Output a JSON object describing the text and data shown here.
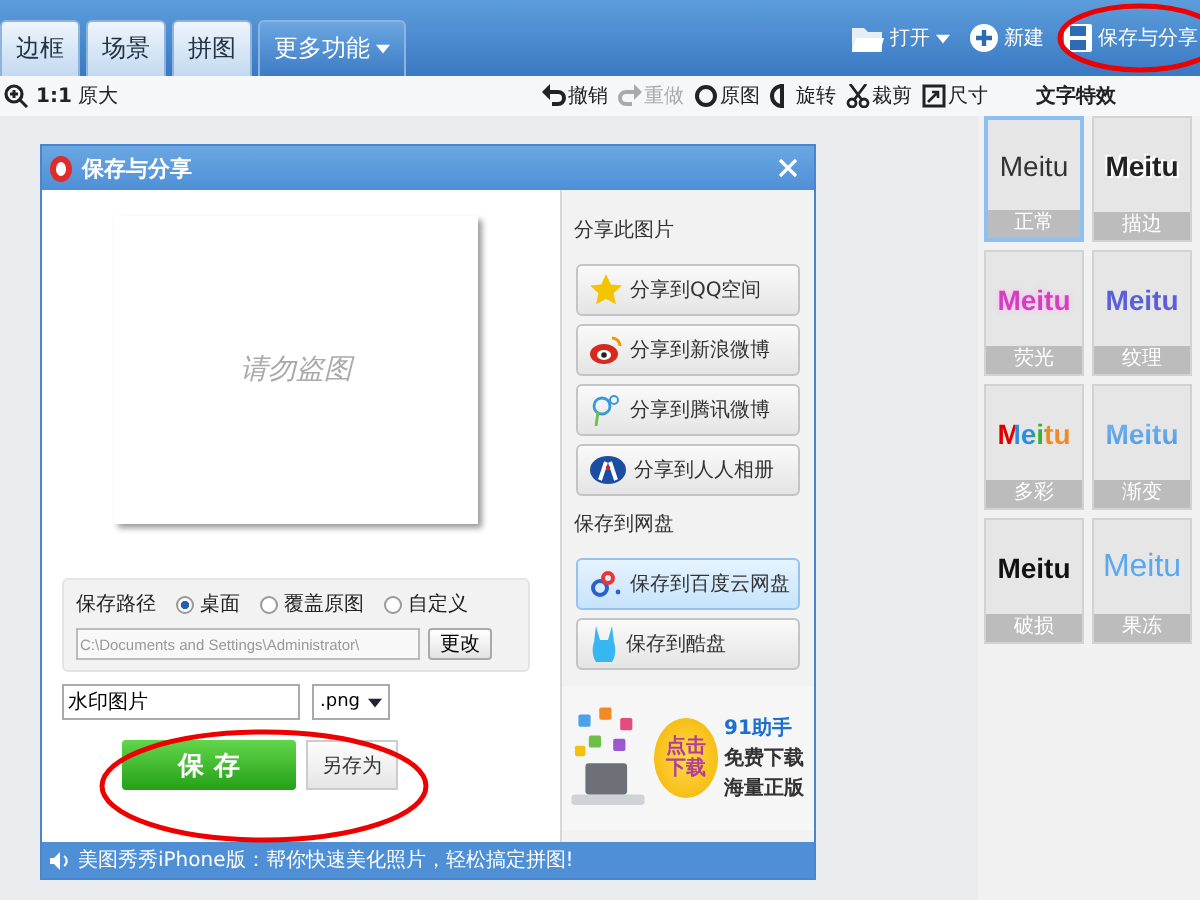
{
  "top_bar": {
    "tabs": [
      {
        "label": "边框",
        "kind": "tab"
      },
      {
        "label": "场景",
        "kind": "tab"
      },
      {
        "label": "拼图",
        "kind": "tab"
      },
      {
        "label": "更多功能",
        "kind": "menu"
      }
    ],
    "actions": [
      {
        "label": "打开",
        "kind": "open"
      },
      {
        "label": "新建",
        "kind": "new"
      },
      {
        "label": "保存与分享",
        "kind": "save"
      }
    ]
  },
  "toolbar": {
    "zoom_ratio": "1:1",
    "zoom_label": "原大",
    "actions": [
      {
        "label": "撤销",
        "kind": "undo",
        "disabled": false
      },
      {
        "label": "重做",
        "kind": "redo",
        "disabled": true
      },
      {
        "label": "原图",
        "kind": "original",
        "disabled": false
      },
      {
        "label": "旋转",
        "kind": "rotate",
        "disabled": false
      },
      {
        "label": "裁剪",
        "kind": "crop",
        "disabled": false
      },
      {
        "label": "尺寸",
        "kind": "resize",
        "disabled": false
      }
    ]
  },
  "effects_panel": {
    "title": "文字特效",
    "items": [
      {
        "sample": "Meitu",
        "label": "正常",
        "kind": "normal",
        "selected": true
      },
      {
        "sample": "Meitu",
        "label": "描边",
        "kind": "outline",
        "selected": false
      },
      {
        "sample": "Meitu",
        "label": "荧光",
        "kind": "glow",
        "selected": false
      },
      {
        "sample": "Meitu",
        "label": "纹理",
        "kind": "texture",
        "selected": false
      },
      {
        "sample": "Meitu",
        "label": "多彩",
        "kind": "multicolor",
        "selected": false
      },
      {
        "sample": "Meitu",
        "label": "渐变",
        "kind": "gradient",
        "selected": false
      },
      {
        "sample": "Meitu",
        "label": "破损",
        "kind": "worn",
        "selected": false
      },
      {
        "sample": "Meitu",
        "label": "果冻",
        "kind": "jelly",
        "selected": false
      }
    ]
  },
  "dialog": {
    "title": "保存与分享",
    "preview": {
      "watermark": "请勿盗图"
    },
    "save_path": {
      "label": "保存路径",
      "options": [
        {
          "label": "桌面",
          "selected": true
        },
        {
          "label": "覆盖原图",
          "selected": false
        },
        {
          "label": "自定义",
          "selected": false
        }
      ],
      "path": "C:\\Documents and Settings\\Administrator\\",
      "change_button": "更改"
    },
    "filename": "水印图片",
    "format": ".png",
    "save_button": "保 存",
    "save_as_button": "另存为",
    "share": {
      "title": "分享此图片",
      "buttons": [
        {
          "label": "分享到QQ空间",
          "kind": "star"
        },
        {
          "label": "分享到新浪微博",
          "kind": "weibo"
        },
        {
          "label": "分享到腾讯微博",
          "kind": "tencent"
        },
        {
          "label": "分享到人人相册",
          "kind": "renren"
        }
      ]
    },
    "cloud": {
      "title": "保存到网盘",
      "buttons": [
        {
          "label": "保存到百度云网盘",
          "kind": "baidu",
          "selected": true
        },
        {
          "label": "保存到酷盘",
          "kind": "kupan",
          "selected": false
        }
      ]
    },
    "ad": {
      "badge": "点击下载",
      "brand": "91助手",
      "slogan": "免费下载",
      "slogan_2": "海量正版"
    },
    "status": "美图秀秀iPhone版：帮你快速美化照片，轻松搞定拼图!"
  }
}
